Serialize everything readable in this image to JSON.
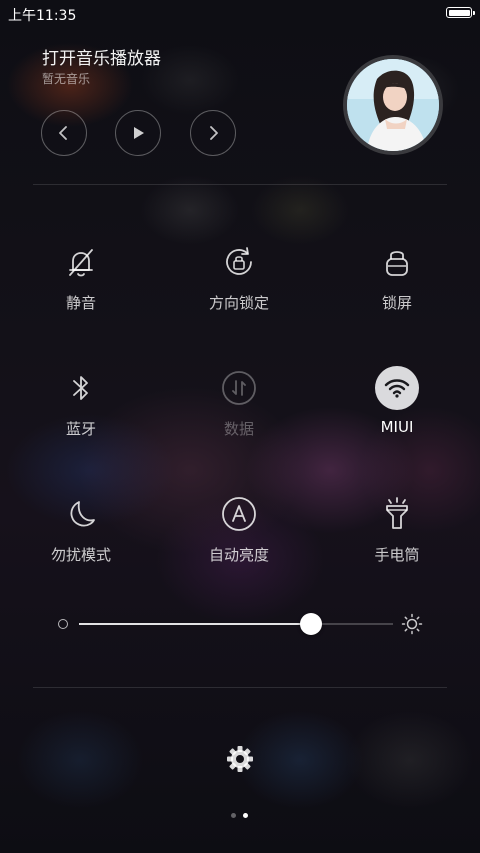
{
  "status_bar": {
    "time": "上午11:35"
  },
  "music": {
    "title": "打开音乐播放器",
    "subtitle": "暂无音乐"
  },
  "toggles": {
    "mute": {
      "label": "静音",
      "icon": "bell-off-icon"
    },
    "rotation_lock": {
      "label": "方向锁定",
      "icon": "rotation-lock-icon"
    },
    "lock_screen": {
      "label": "锁屏",
      "icon": "lock-icon"
    },
    "bluetooth": {
      "label": "蓝牙",
      "icon": "bluetooth-icon"
    },
    "mobile_data": {
      "label": "数据",
      "icon": "data-arrows-icon",
      "state": "disabled"
    },
    "wifi": {
      "label": "MIUI",
      "icon": "wifi-icon",
      "state": "active"
    },
    "do_not_disturb": {
      "label": "勿扰模式",
      "icon": "moon-icon"
    },
    "auto_brightness": {
      "label": "自动亮度",
      "icon": "auto-brightness-icon"
    },
    "flashlight": {
      "label": "手电筒",
      "icon": "flashlight-icon"
    }
  },
  "brightness": {
    "level": 0.74
  },
  "pager": {
    "pages": 2,
    "current": 2
  },
  "colors": {
    "active_toggle_bg": "#ebebee",
    "text": "#ffffff"
  }
}
